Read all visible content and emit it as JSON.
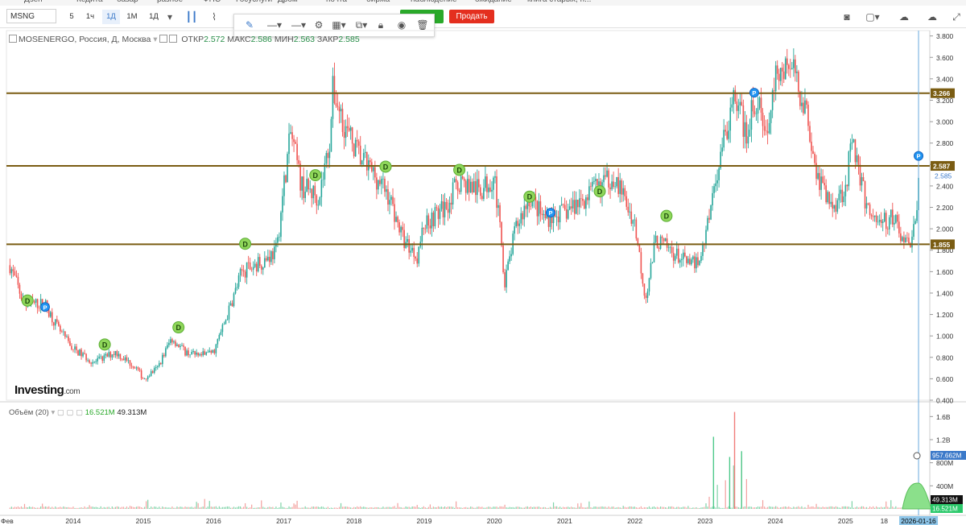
{
  "bookmarks": [
    "Дзен",
    "Кедита",
    "базар",
    "разное",
    "ФНС",
    "Госуслуги",
    "Дром",
    "почта",
    "биржа",
    "наблюдение",
    "ожидание",
    "книга старых, н..."
  ],
  "toolbar": {
    "symbol": "MSNG",
    "timeframes": [
      "5",
      "1ч",
      "1Д",
      "1М",
      "1Д"
    ],
    "active_timeframe_index": 2,
    "sell_label": "Продать",
    "buy_label": ""
  },
  "legend": {
    "title": "MOSENERGO, Россия, Д, Москва",
    "open_label": "ОТКР",
    "open": "2.572",
    "high_label": "МАКС",
    "high": "2.586",
    "low_label": "МИН",
    "low": "2.563",
    "close_label": "ЗАКР",
    "close": "2.585"
  },
  "volume_legend": {
    "label": "Объём (20)",
    "v1": "16.521M",
    "v2": "49.313M"
  },
  "logo": {
    "main": "Investing",
    "suffix": ".com"
  },
  "colors": {
    "up": "#26a69a",
    "down": "#ef5350",
    "level_line": "#7a5c12",
    "current": "#3b79c9",
    "dividend": "#8fd65a",
    "report": "#2196f3"
  },
  "chart_data": {
    "type": "candlestick",
    "x_ticks": [
      "Фев",
      "2014",
      "2015",
      "2016",
      "2017",
      "2018",
      "2019",
      "2020",
      "2021",
      "2022",
      "2023",
      "2024",
      "2025",
      "18",
      "2026-01-16"
    ],
    "y_ticks": [
      "3.800",
      "3.600",
      "3.400",
      "3.200",
      "3.000",
      "2.800",
      "2.600",
      "2.400",
      "2.200",
      "2.000",
      "1.800",
      "1.600",
      "1.400",
      "1.200",
      "1.000",
      "0.800",
      "0.600",
      "0.400"
    ],
    "ylim": [
      0.4,
      3.85
    ],
    "price_path": [
      [
        2013.1,
        1.66
      ],
      [
        2013.3,
        1.3
      ],
      [
        2013.6,
        1.3
      ],
      [
        2013.8,
        1.05
      ],
      [
        2014.0,
        0.88
      ],
      [
        2014.3,
        0.75
      ],
      [
        2014.6,
        0.85
      ],
      [
        2014.9,
        0.7
      ],
      [
        2015.0,
        0.6
      ],
      [
        2015.2,
        0.7
      ],
      [
        2015.4,
        0.98
      ],
      [
        2015.6,
        0.85
      ],
      [
        2015.8,
        0.82
      ],
      [
        2016.0,
        0.85
      ],
      [
        2016.2,
        1.2
      ],
      [
        2016.4,
        1.6
      ],
      [
        2016.7,
        1.7
      ],
      [
        2016.9,
        1.8
      ],
      [
        2017.0,
        2.4
      ],
      [
        2017.1,
        2.9
      ],
      [
        2017.25,
        2.4
      ],
      [
        2017.5,
        2.3
      ],
      [
        2017.65,
        2.8
      ],
      [
        2017.7,
        3.3
      ],
      [
        2017.9,
        2.9
      ],
      [
        2018.1,
        2.65
      ],
      [
        2018.3,
        2.5
      ],
      [
        2018.5,
        2.3
      ],
      [
        2018.7,
        1.9
      ],
      [
        2018.9,
        1.75
      ],
      [
        2019.0,
        2.05
      ],
      [
        2019.3,
        2.2
      ],
      [
        2019.5,
        2.45
      ],
      [
        2019.8,
        2.35
      ],
      [
        2020.0,
        2.5
      ],
      [
        2020.15,
        1.5
      ],
      [
        2020.3,
        2.0
      ],
      [
        2020.5,
        2.3
      ],
      [
        2020.7,
        2.1
      ],
      [
        2021.0,
        2.15
      ],
      [
        2021.3,
        2.3
      ],
      [
        2021.5,
        2.4
      ],
      [
        2021.7,
        2.5
      ],
      [
        2021.9,
        2.2
      ],
      [
        2022.0,
        2.05
      ],
      [
        2022.15,
        1.35
      ],
      [
        2022.3,
        1.9
      ],
      [
        2022.6,
        1.75
      ],
      [
        2022.8,
        1.65
      ],
      [
        2022.95,
        1.75
      ],
      [
        2023.1,
        2.3
      ],
      [
        2023.25,
        2.8
      ],
      [
        2023.4,
        3.2
      ],
      [
        2023.6,
        2.9
      ],
      [
        2023.7,
        3.2
      ],
      [
        2023.9,
        2.9
      ],
      [
        2024.0,
        3.4
      ],
      [
        2024.2,
        3.55
      ],
      [
        2024.4,
        3.2
      ],
      [
        2024.5,
        2.9
      ],
      [
        2024.6,
        2.5
      ],
      [
        2024.8,
        2.2
      ],
      [
        2025.0,
        2.4
      ],
      [
        2025.1,
        2.85
      ],
      [
        2025.3,
        2.2
      ],
      [
        2025.5,
        2.05
      ],
      [
        2025.7,
        2.1
      ],
      [
        2025.8,
        1.9
      ],
      [
        2025.9,
        1.87
      ],
      [
        2026.0,
        2.0
      ],
      [
        2026.04,
        2.585
      ]
    ],
    "levels": [
      "3.266",
      "2.587",
      "1.855"
    ],
    "current_price": "2.585",
    "volume_ticks": [
      "1.6B",
      "1.2B",
      "800M",
      "400M"
    ],
    "volume_ylim": [
      0,
      1.8
    ],
    "volume_labels": {
      "cursor": "957.662M",
      "avg": "49.313M",
      "last": "16.521M"
    },
    "event_markers": [
      {
        "type": "D",
        "x": 2013.35,
        "y": 1.33
      },
      {
        "type": "P",
        "x": 2013.6,
        "y": 1.27
      },
      {
        "type": "D",
        "x": 2014.45,
        "y": 0.92
      },
      {
        "type": "D",
        "x": 2015.5,
        "y": 1.08
      },
      {
        "type": "D",
        "x": 2016.45,
        "y": 1.86
      },
      {
        "type": "D",
        "x": 2017.45,
        "y": 2.5
      },
      {
        "type": "D",
        "x": 2018.45,
        "y": 2.58
      },
      {
        "type": "D",
        "x": 2019.5,
        "y": 2.55
      },
      {
        "type": "D",
        "x": 2020.5,
        "y": 2.3
      },
      {
        "type": "P",
        "x": 2020.8,
        "y": 2.15
      },
      {
        "type": "D",
        "x": 2021.5,
        "y": 2.35
      },
      {
        "type": "D",
        "x": 2022.45,
        "y": 2.12
      },
      {
        "type": "P",
        "x": 2023.7,
        "y": 3.27
      },
      {
        "type": "P",
        "x": 2026.04,
        "y": 2.68
      }
    ]
  }
}
